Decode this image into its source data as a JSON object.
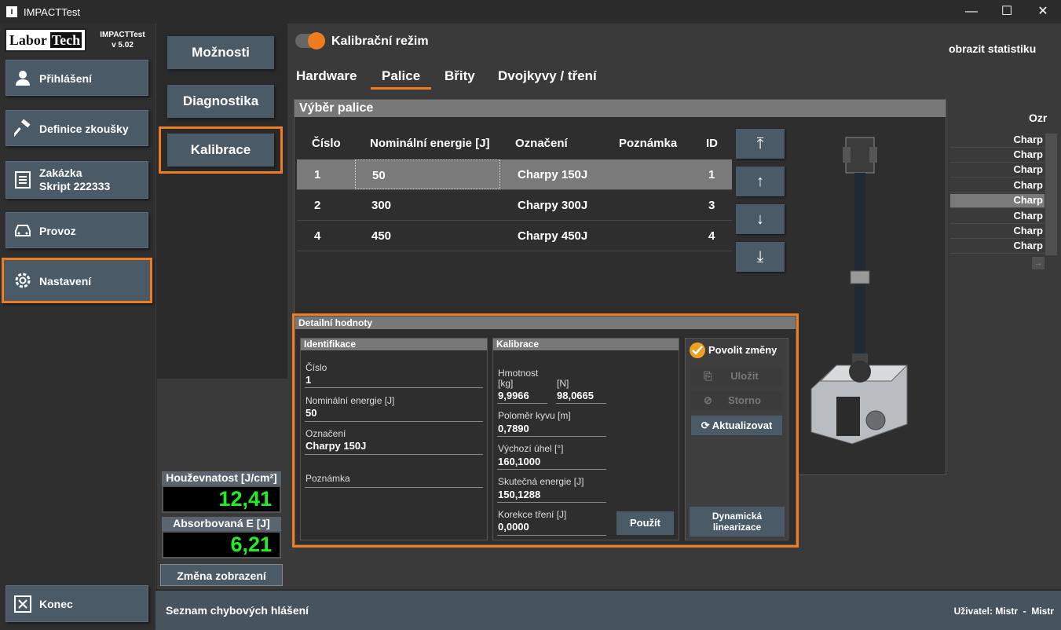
{
  "app": {
    "title": "IMPACTTest",
    "logo_left": "Labor",
    "logo_right": "Tech",
    "name": "IMPACTTest",
    "version": "v 5.02"
  },
  "window": {
    "minimize": "—",
    "maximize": "☐",
    "close": "✕"
  },
  "nav": {
    "items": [
      {
        "label": "Přihlášení"
      },
      {
        "label": "Definice zkoušky"
      },
      {
        "label": "Zakázka",
        "label2": "Skript 222333"
      },
      {
        "label": "Provoz"
      },
      {
        "label": "Nastavení"
      }
    ],
    "exit": "Konec"
  },
  "sub_nav": {
    "items": [
      "Možnosti",
      "Diagnostika",
      "Kalibrace"
    ]
  },
  "displays": {
    "toughness_label": "Houževnatost [J/cm²]",
    "toughness_value": "12,41",
    "absorbed_label": "Absorbovaná E [J]",
    "absorbed_value": "6,21",
    "change_view": "Změna zobrazení"
  },
  "header": {
    "mode_label": "Kalibrační režim",
    "show_stats": "obrazit statistiku"
  },
  "tabs": [
    "Hardware",
    "Palice",
    "Břity",
    "Dvojkyvy / tření"
  ],
  "hammer_select": {
    "title": "Výběr palice",
    "columns": [
      "Číslo",
      "Nominální energie [J]",
      "Označení",
      "Poznámka",
      "ID"
    ],
    "rows": [
      {
        "cislo": "1",
        "energie": "50",
        "oznaceni": "Charpy 150J",
        "poznamka": "",
        "id": "1"
      },
      {
        "cislo": "2",
        "energie": "300",
        "oznaceni": "Charpy 300J",
        "poznamka": "",
        "id": "3"
      },
      {
        "cislo": "4",
        "energie": "450",
        "oznaceni": "Charpy 450J",
        "poznamka": "",
        "id": "4"
      }
    ]
  },
  "arrows": [
    "⤒",
    "↑",
    "↓",
    "⤓"
  ],
  "detail": {
    "title": "Detailní hodnoty",
    "identification": {
      "title": "Identifikace",
      "cislo_label": "Číslo",
      "cislo": "1",
      "energie_label": "Nominální energie [J]",
      "energie": "50",
      "oznaceni_label": "Označení",
      "oznaceni": "Charpy 150J",
      "poznamka_label": "Poznámka",
      "poznamka": ""
    },
    "calibration": {
      "title": "Kalibrace",
      "mass_label": "Hmotnost",
      "kg": "[kg]",
      "n": "[N]",
      "mass_kg": "9,9966",
      "mass_n": "98,0665",
      "radius_label": "Poloměr kyvu [m]",
      "radius": "0,7890",
      "angle_label": "Výchozí úhel [°]",
      "angle": "160,1000",
      "energy_label": "Skutečná energie [J]",
      "energy": "150,1288",
      "friction_label": "Korekce tření [J]",
      "friction": "0,0000",
      "apply": "Použít"
    },
    "actions": {
      "allow_changes": "Povolit změny",
      "save": "Uložit",
      "cancel": "Storno",
      "refresh": "Aktualizovat",
      "dynamic": "Dynamická linearizace"
    }
  },
  "background_list": {
    "header": "Ozr",
    "items": [
      "Charp",
      "Charp",
      "Charp",
      "Charp",
      "Charp",
      "Charp",
      "Charp",
      "Charp"
    ]
  },
  "bottom": {
    "errors": "Seznam chybových hlášení",
    "user": "Uživatel: Mistr  -  Mistr"
  },
  "colors": {
    "accent": "#f07c20",
    "button": "#4a5a66",
    "digits": "#22ee22"
  }
}
